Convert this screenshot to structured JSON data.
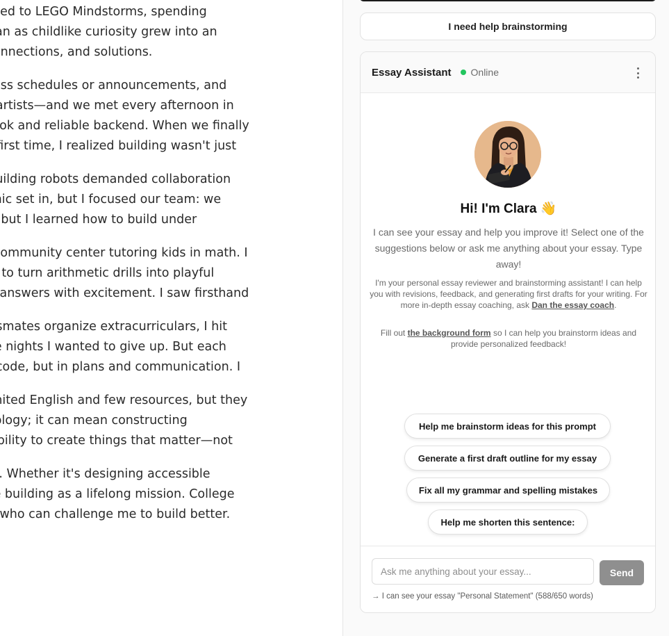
{
  "essay": {
    "paragraphs": [
      [
        "graded to LEGO Mindstorms, spending",
        "began as childlike curiosity grew into an",
        "s, connections, and solutions."
      ],
      [
        "access schedules or announcements, and",
        "ere artists—and we met every afternoon in",
        "rn look and reliable backend. When we finally",
        " the first time, I realized building wasn't just"
      ],
      [
        "d, building robots demanded collaboration",
        ". Panic set in, but I focused our team: we",
        " win, but I learned how to build under"
      ],
      [
        "cal community center tutoring kids in math. I",
        "rials to turn arithmetic drills into playful",
        "ting answers with excitement. I saw firsthand"
      ],
      [
        "classmates organize extracurriculars, I hit",
        "were nights I wanted to give up. But each",
        "t in code, but in plans and communication. I"
      ],
      [
        "n limited English and few resources, but they",
        "chnology; it can mean constructing",
        "onsibility to create things that matter—not"
      ],
      [
        "pact. Whether it's designing accessible",
        " I see building as a lifelong mission. College",
        "tors who can challenge me to build better."
      ]
    ]
  },
  "sidebar": {
    "brainstorm_button": "I need help brainstorming"
  },
  "chat": {
    "title": "Essay Assistant",
    "status": "Online",
    "status_color": "#22c55e",
    "greeting": "Hi! I'm Clara 👋",
    "intro": "I can see your essay and help you improve it! Select one of the suggestions below or ask me anything about your essay. Type away!",
    "note1_text": "I'm your personal essay reviewer and brainstorming assistant! I can help you with revisions, feedback, and generating first drafts for your writing. For more in-depth essay coaching, ask ",
    "note1_link": "Dan the essay coach",
    "note1_end": ".",
    "note2_start": "Fill out ",
    "note2_link": "the background form",
    "note2_end": " so I can help you brainstorm ideas and provide personalized feedback!",
    "suggestions": [
      "Help me brainstorm ideas for this prompt",
      "Generate a first draft outline for my essay",
      "Fix all my grammar and spelling mistakes",
      "Help me shorten this sentence:"
    ],
    "input_placeholder": "Ask me anything about your essay...",
    "send_label": "Send",
    "context": "→ I can see your essay \"Personal Statement\" (588/650 words)"
  }
}
